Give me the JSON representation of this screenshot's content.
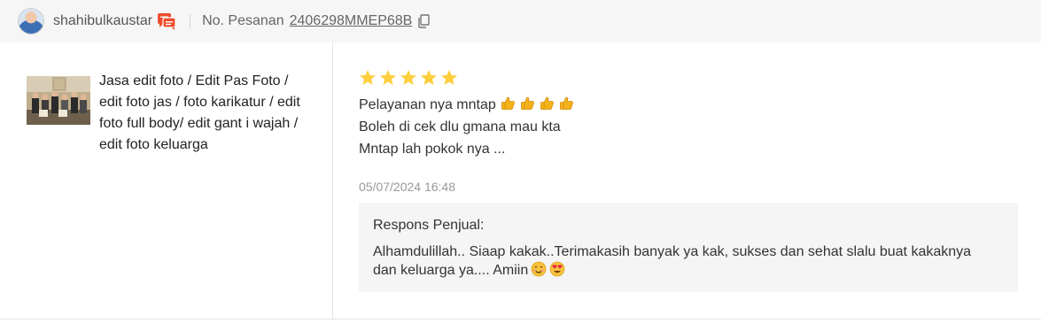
{
  "header": {
    "username": "shahibulkaustar",
    "order_label": "No. Pesanan",
    "order_number": "2406298MMEP68B",
    "icons": {
      "avatar": "user-avatar",
      "chat": "chat-icon",
      "copy": "copy-icon"
    },
    "accent_color": "#ee4d2d"
  },
  "product": {
    "name": "Jasa edit foto / Edit Pas Foto / edit foto jas / foto karikatur / edit foto full body/ edit gant i wajah / edit foto keluarga"
  },
  "review": {
    "rating": 5,
    "max_rating": 5,
    "star_color": "#ffce3d",
    "lines": [
      "Pelayanan nya mntap",
      "Boleh di cek dlu gmana mau kta",
      "Mntap lah pokok nya ..."
    ],
    "thumbs_up_count": 4,
    "date": "05/07/2024 16:48"
  },
  "seller_response": {
    "title": "Respons Penjual:",
    "text": "Alhamdulillah.. Siaap kakak..Terimakasih banyak ya kak, sukses dan sehat slalu buat kakaknya dan keluarga ya.... Amiin",
    "emojis": [
      "smiling-face-emoji",
      "heart-eyes-emoji"
    ]
  }
}
